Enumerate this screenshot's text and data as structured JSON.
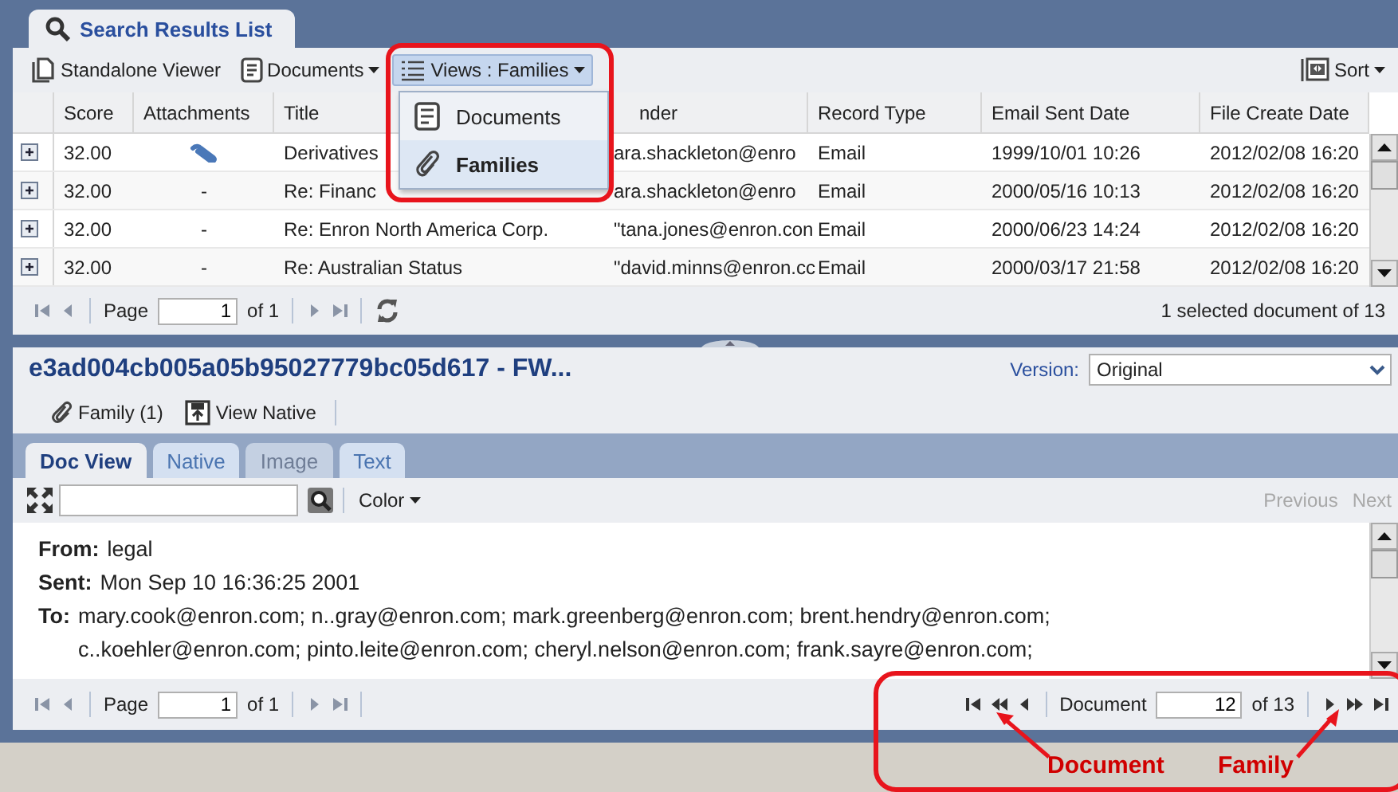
{
  "tab": {
    "label": "Search Results List",
    "selected": true
  },
  "toolbar": {
    "items": [
      {
        "label": "Standalone Viewer",
        "kind": "viewer"
      },
      {
        "label": "Documents",
        "kind": "documents"
      },
      {
        "label": "Views : Families",
        "kind": "views"
      }
    ],
    "sort": "Sort"
  },
  "views_menu": {
    "open": true,
    "items": [
      {
        "label": "Documents",
        "kind": "documents",
        "selected": false
      },
      {
        "label": "Families",
        "kind": "families",
        "selected": true
      }
    ]
  },
  "grid": {
    "columns": [
      "Score",
      "Attachments",
      "Title",
      "nder",
      "Record Type",
      "Email Sent Date",
      "File Create Date"
    ],
    "rows": [
      {
        "score": "32.00",
        "attachment_icon": true,
        "title": "Derivatives",
        "sender": "ara.shackleton@enro",
        "record_type": "Email",
        "sent": "1999/10/01 10:26",
        "created": "2012/02/08 16:20"
      },
      {
        "score": "32.00",
        "attachment_icon": false,
        "attachments": "-",
        "title": "Re: Financ",
        "sender": "ara.shackleton@enro",
        "record_type": "Email",
        "sent": "2000/05/16 10:13",
        "created": "2012/02/08 16:20"
      },
      {
        "score": "32.00",
        "attachment_icon": false,
        "attachments": "-",
        "title": "Re: Enron North America Corp.",
        "sender": "\"tana.jones@enron.con",
        "record_type": "Email",
        "sent": "2000/06/23 14:24",
        "created": "2012/02/08 16:20"
      },
      {
        "score": "32.00",
        "attachment_icon": false,
        "attachments": "-",
        "title": "Re: Australian Status",
        "sender": "\"david.minns@enron.cc",
        "record_type": "Email",
        "sent": "2000/03/17 21:58",
        "created": "2012/02/08 16:20"
      }
    ]
  },
  "pager": {
    "page_label": "Page",
    "page": "1",
    "of": "of 1",
    "status": "1 selected document of 13"
  },
  "document": {
    "title": "e3ad004cb005a05b95027779bc05d617 - FW...",
    "version_label": "Version:",
    "version": "Original",
    "actions": [
      {
        "label": "Family (1)",
        "kind": "family"
      },
      {
        "label": "View Native",
        "kind": "native"
      }
    ],
    "tabs": [
      {
        "label": "Doc View",
        "selected": true,
        "disabled": false
      },
      {
        "label": "Native",
        "selected": false,
        "disabled": false
      },
      {
        "label": "Image",
        "selected": false,
        "disabled": true
      },
      {
        "label": "Text",
        "selected": false,
        "disabled": false
      }
    ],
    "color_menu": "Color",
    "previous": {
      "label": "Previous",
      "disabled": true
    },
    "next": {
      "label": "Next",
      "disabled": true
    },
    "fields": [
      {
        "label": "From:",
        "value": "legal"
      },
      {
        "label": "Sent:",
        "value": "Mon Sep 10 16:36:25 2001"
      },
      {
        "label": "To:",
        "value": "mary.cook@enron.com; n..gray@enron.com; mark.greenberg@enron.com; brent.hendry@enron.com; c..koehler@enron.com; pinto.leite@enron.com; cheryl.nelson@enron.com; frank.sayre@enron.com;"
      }
    ],
    "pager": {
      "page_label": "Page",
      "page": "1",
      "of": "of 1"
    },
    "doc_nav": {
      "label": "Document",
      "value": "12",
      "of": "of 13"
    }
  },
  "annotations": [
    {
      "label": "Document",
      "kind": "document"
    },
    {
      "label": "Family",
      "kind": "family"
    }
  ]
}
